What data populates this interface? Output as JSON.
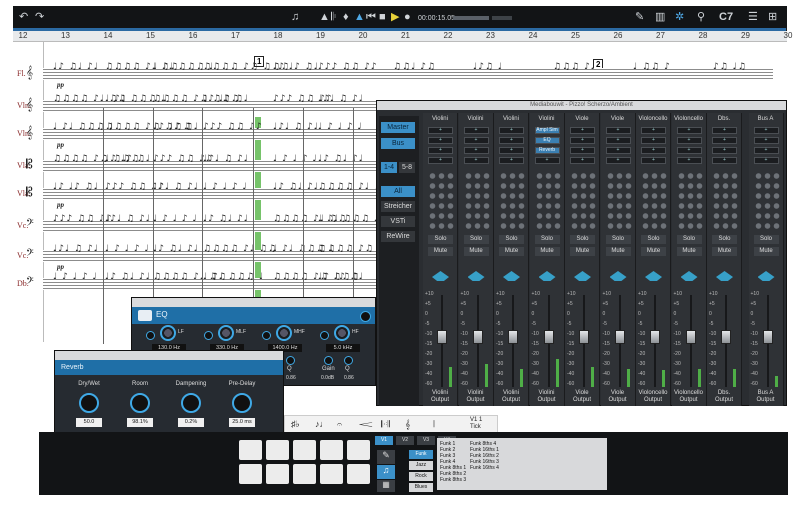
{
  "toolbar": {
    "time": "00:00:15.05",
    "key": "C7",
    "icons": [
      "undo-icon",
      "redo-icon",
      "mixer-icon",
      "metronome-icon",
      "marker-icon",
      "tuner-icon",
      "rewind-icon",
      "stop-icon",
      "play-icon",
      "record-icon",
      "pencil-icon",
      "keyboard-icon",
      "instrument-icon",
      "guitar-icon",
      "list-icon",
      "settings-icon"
    ]
  },
  "ruler": {
    "marks": [
      "12",
      "13",
      "14",
      "15",
      "16",
      "17",
      "18",
      "19",
      "20",
      "21",
      "22",
      "23",
      "24",
      "25",
      "26",
      "27",
      "28",
      "29",
      "30"
    ]
  },
  "score": {
    "instruments": [
      "Fl.",
      "Vln.",
      "Vln.",
      "Vla.",
      "Vla.",
      "Vc.",
      "Vc.",
      "Db."
    ],
    "rehearsal_marks": [
      "1",
      "2"
    ],
    "dynamic": "pp"
  },
  "mixer": {
    "title": "Mediabouwit - Pizzo! Scherzo/Ambient",
    "nav": [
      "Master",
      "Bus",
      "1-4",
      "5-8",
      "All",
      "Streicher",
      "VSTi",
      "ReWire"
    ],
    "channels": [
      {
        "name": "Violini",
        "output": "Violini",
        "output_label": "Output",
        "solo": "Solo",
        "mute": "Mute",
        "fader": 0.55,
        "meter": 0.22,
        "slots": []
      },
      {
        "name": "Violini",
        "output": "Violini",
        "output_label": "Output",
        "solo": "Solo",
        "mute": "Mute",
        "fader": 0.55,
        "meter": 0.25,
        "slots": []
      },
      {
        "name": "Violini",
        "output": "Violini",
        "output_label": "Output",
        "solo": "Solo",
        "mute": "Mute",
        "fader": 0.55,
        "meter": 0.2,
        "slots": []
      },
      {
        "name": "Violini",
        "output": "Violini",
        "output_label": "Output",
        "solo": "Solo",
        "mute": "Mute",
        "fader": 0.55,
        "meter": 0.3,
        "slots": [
          "Ampl Sim",
          "EQ",
          "Reverb"
        ]
      },
      {
        "name": "Viole",
        "output": "Viole",
        "output_label": "Output",
        "solo": "Solo",
        "mute": "Mute",
        "fader": 0.55,
        "meter": 0.22,
        "slots": []
      },
      {
        "name": "Viole",
        "output": "Viole",
        "output_label": "Output",
        "solo": "Solo",
        "mute": "Mute",
        "fader": 0.55,
        "meter": 0.2,
        "slots": []
      },
      {
        "name": "Violoncello",
        "output": "Violoncello",
        "output_label": "Output",
        "solo": "Solo",
        "mute": "Mute",
        "fader": 0.55,
        "meter": 0.18,
        "slots": []
      },
      {
        "name": "Violoncello",
        "output": "Violoncello",
        "output_label": "Output",
        "solo": "Solo",
        "mute": "Mute",
        "fader": 0.55,
        "meter": 0.2,
        "slots": []
      },
      {
        "name": "Dbs.",
        "output": "Dbs.",
        "output_label": "Output",
        "solo": "Solo",
        "mute": "Mute",
        "fader": 0.55,
        "meter": 0.2,
        "slots": []
      },
      {
        "name": "Bus A",
        "output": "Bus A",
        "output_label": "Output",
        "solo": "Solo",
        "mute": "Mute",
        "fader": 0.55,
        "meter": 0.12,
        "slots": []
      }
    ],
    "scale": [
      "+10",
      "+5",
      "0",
      "-5",
      "-10",
      "-15",
      "-20",
      "-30",
      "-40",
      "-60"
    ]
  },
  "eq": {
    "title": "EQ",
    "bands": [
      {
        "type": "LF",
        "freq": "130.0 Hz",
        "gain": "0.0dB",
        "q": "0.86"
      },
      {
        "type": "MLF",
        "freq": "330.0 Hz",
        "gain": "0.0dB",
        "q": "0.86"
      },
      {
        "type": "MHF",
        "freq": "1400.0 Hz",
        "gain": "0.0dB",
        "q": "0.86"
      },
      {
        "type": "HF",
        "freq": "5.0 kHz",
        "gain": "0.0dB",
        "q": "0.86"
      }
    ],
    "gain_label": "Gain",
    "q_label": "Q"
  },
  "reverb": {
    "title": "Reverb",
    "params": [
      {
        "label": "Dry/Wet",
        "value": "50.0"
      },
      {
        "label": "Room",
        "value": "98.1%"
      },
      {
        "label": "Dampening",
        "value": "0.2%"
      },
      {
        "label": "Pre-Delay",
        "value": "25.0 ms"
      }
    ]
  },
  "palette": {
    "symbols": [
      "♯♭",
      "♪♩",
      "𝄐",
      "𝆒",
      "𝄆𝄇",
      "𝄞",
      "𝄁"
    ],
    "label": "V1 1",
    "label2": "Tick"
  },
  "drums": {
    "categories": [
      "V1",
      "V2",
      "V3",
      "V4"
    ],
    "kits": [
      "Funk",
      "Jazz",
      "Rock",
      "Blues"
    ],
    "patterns_left": [
      "Funk 1",
      "Funk 2",
      "Funk 3",
      "Funk 4",
      "Funk 8ths 1",
      "Funk 8ths 2",
      "Funk 8ths 3"
    ],
    "patterns_right": [
      "Funk 8ths 4",
      "Funk 16ths 1",
      "Funk 16ths 2",
      "Funk 16ths 3",
      "Funk 16ths 4"
    ]
  }
}
